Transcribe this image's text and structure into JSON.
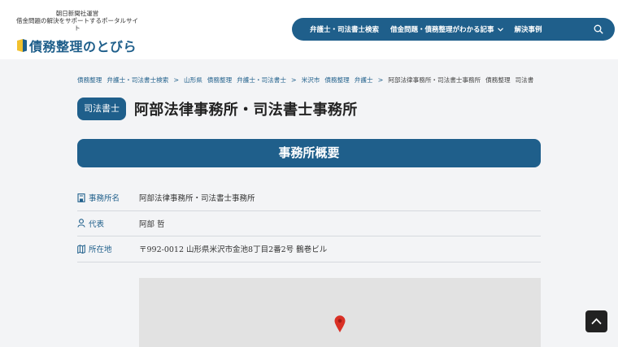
{
  "header": {
    "tagline_line1": "朝日新聞社運営",
    "tagline_line2": "借金問題の解決をサポートするポータルサイト",
    "site_name": "債務整理のとびら",
    "nav": [
      {
        "label": "弁護士・司法書士検索"
      },
      {
        "label": "借金問題・債務整理がわかる記事"
      },
      {
        "label": "解決事例"
      }
    ]
  },
  "breadcrumb": [
    "債務整理",
    "弁護士・司法書士検索",
    "山形県",
    "債務整理",
    "弁護士・司法書士",
    "米沢市",
    "債務整理",
    "弁護士",
    "阿部法律事務所・司法書士事務所",
    "債務整理",
    "司法書"
  ],
  "badge": "司法書士",
  "page_title": "阿部法律事務所・司法書士事務所",
  "section_title": "事務所概要",
  "info": {
    "office_name_label": "事務所名",
    "office_name_value": "阿部法律事務所・司法書士事務所",
    "representative_label": "代表",
    "representative_value": "阿部 哲",
    "address_label": "所在地",
    "address_value": "〒992-0012 山形県米沢市金池8丁目2番2号 鶴巻ビル"
  },
  "icons": {
    "brand": "door-logo-icon",
    "nav_dropdown": "chevron-down-icon",
    "search": "search-icon",
    "office": "building-icon",
    "person": "person-icon",
    "map": "map-icon",
    "pin": "map-pin-icon",
    "scroll_top": "chevron-up-icon"
  },
  "colors": {
    "brand_blue": "#1f5f8b",
    "pin_red": "#d93025"
  }
}
